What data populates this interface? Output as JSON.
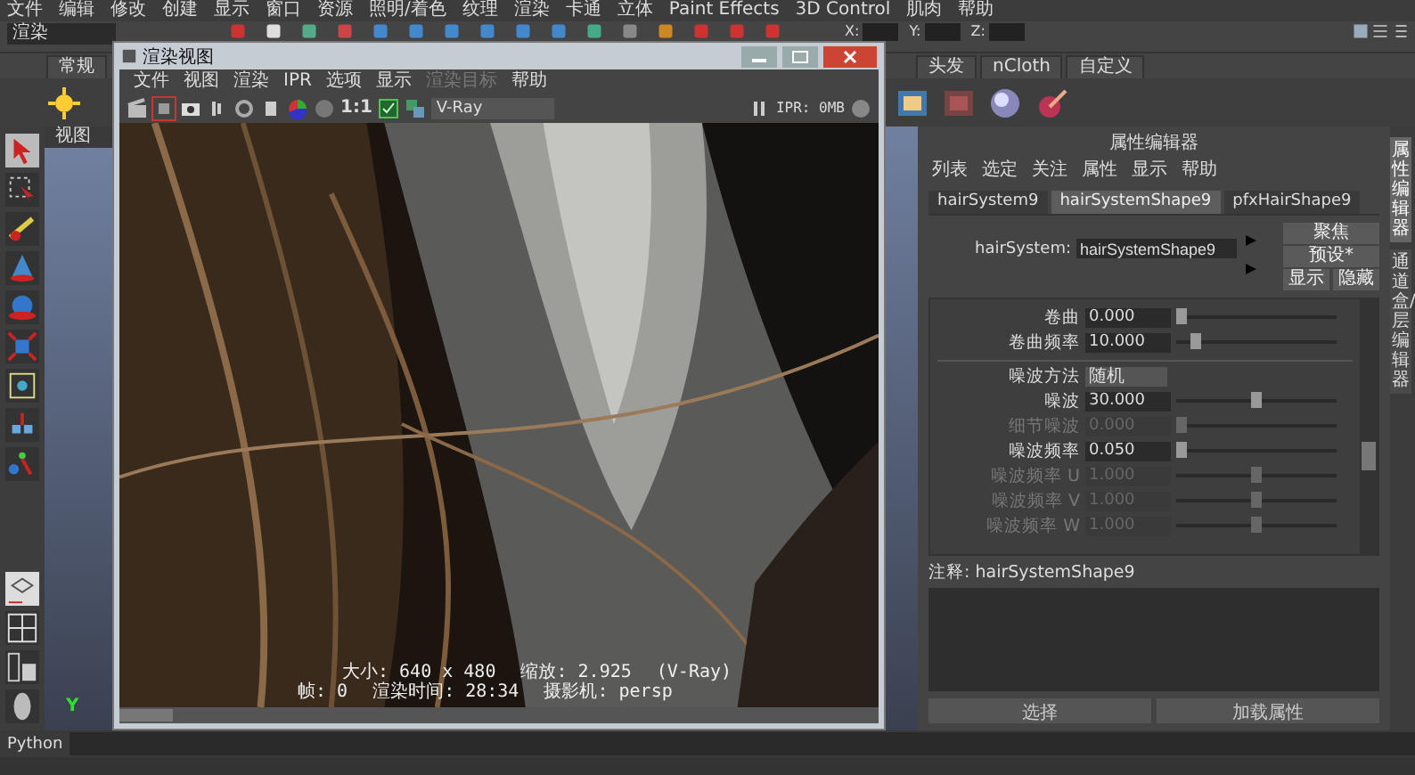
{
  "menu_bar": {
    "items": [
      "文件",
      "编辑",
      "修改",
      "创建",
      "显示",
      "窗口",
      "资源",
      "照明/着色",
      "纹理",
      "渲染",
      "卡通",
      "立体",
      "Paint Effects",
      "3D Control",
      "肌肉",
      "帮助"
    ]
  },
  "toolbar": {
    "mode": "渲染",
    "x_label": "X:",
    "y_label": "Y:",
    "z_label": "Z:"
  },
  "shelf": {
    "tabs_left": [
      "常规"
    ],
    "tabs_right": [
      "头发",
      "nCloth",
      "自定义"
    ]
  },
  "viewport": {
    "menu": [
      "视图"
    ],
    "axis_label": "Y"
  },
  "render_view": {
    "title": "渲染视图",
    "menu": [
      {
        "label": "文件",
        "disabled": false
      },
      {
        "label": "视图",
        "disabled": false
      },
      {
        "label": "渲染",
        "disabled": false
      },
      {
        "label": "IPR",
        "disabled": false
      },
      {
        "label": "选项",
        "disabled": false
      },
      {
        "label": "显示",
        "disabled": false
      },
      {
        "label": "渲染目标",
        "disabled": true
      },
      {
        "label": "帮助",
        "disabled": false
      }
    ],
    "zoom_label": "1:1",
    "renderer": "V-Ray",
    "ipr_status": "IPR: 0MB",
    "info_lines": [
      [
        "大小: 640 x 480",
        "缩放: 2.925",
        "(V-Ray)"
      ],
      [
        "帧: 0",
        "渲染时间: 28:34",
        "摄影机: persp"
      ]
    ]
  },
  "attribute_editor": {
    "title": "属性编辑器",
    "menu": [
      "列表",
      "选定",
      "关注",
      "属性",
      "显示",
      "帮助"
    ],
    "tabs": [
      {
        "label": "hairSystem9",
        "selected": false
      },
      {
        "label": "hairSystemShape9",
        "selected": true
      },
      {
        "label": "pfxHairShape9",
        "selected": false
      }
    ],
    "node_label": "hairSystem:",
    "node_value": "hairSystemShape9",
    "buttons": [
      "聚焦",
      "预设*",
      "显示",
      "隐藏"
    ],
    "sections": [
      {
        "rows": [
          {
            "kind": "slider",
            "label": "卷曲",
            "value": "0.000",
            "level": 0.0,
            "disabled": false
          },
          {
            "kind": "slider",
            "label": "卷曲频率",
            "value": "10.000",
            "level": 0.1,
            "disabled": false
          }
        ]
      },
      {
        "rows": [
          {
            "kind": "dropdown",
            "label": "噪波方法",
            "value": "随机",
            "disabled": false
          },
          {
            "kind": "slider",
            "label": "噪波",
            "value": "30.000",
            "level": 0.5,
            "disabled": false
          },
          {
            "kind": "slider",
            "label": "细节噪波",
            "value": "0.000",
            "level": 0.0,
            "disabled": true
          },
          {
            "kind": "slider",
            "label": "噪波频率",
            "value": "0.050",
            "level": 0.0,
            "disabled": false
          },
          {
            "kind": "slider",
            "label": "噪波频率 U",
            "value": "1.000",
            "level": 0.5,
            "disabled": true
          },
          {
            "kind": "slider",
            "label": "噪波频率 V",
            "value": "1.000",
            "level": 0.5,
            "disabled": true
          },
          {
            "kind": "slider",
            "label": "噪波频率 W",
            "value": "1.000",
            "level": 0.5,
            "disabled": true
          }
        ]
      }
    ],
    "notes_label": "注释: hairSystemShape9",
    "bottom_buttons": [
      "选择",
      "加载属性"
    ]
  },
  "side_tabs": [
    {
      "label": "属性编辑器",
      "selected": true
    },
    {
      "label": "通道盒/层编辑器",
      "selected": false
    }
  ],
  "python_bar": {
    "label": "Python"
  }
}
